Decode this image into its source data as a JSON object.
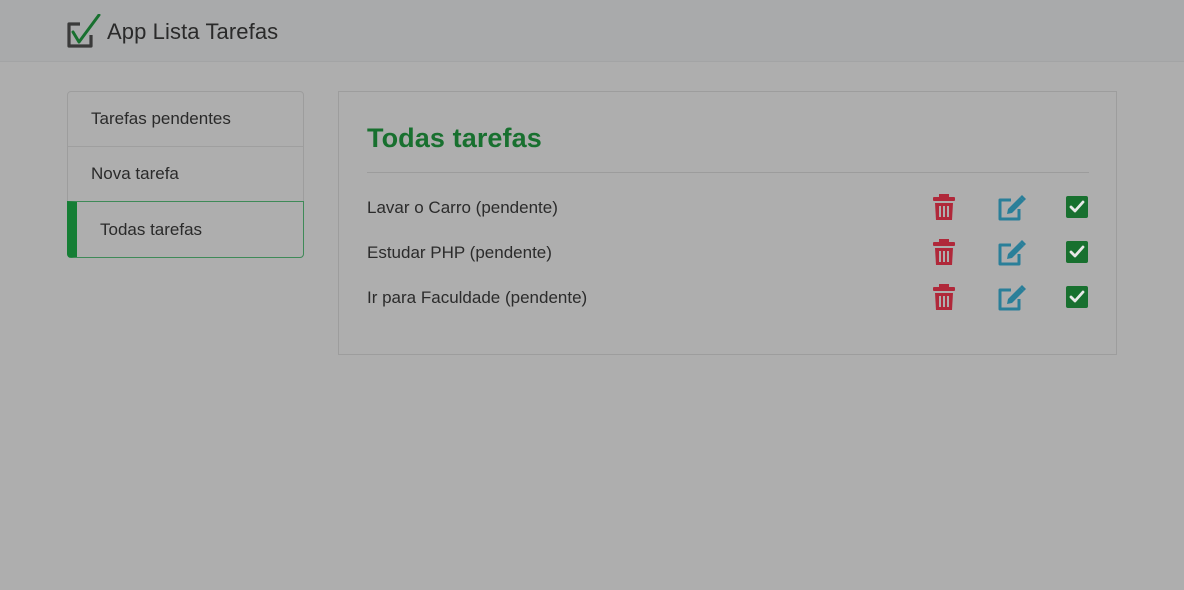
{
  "app": {
    "title": "App Lista Tarefas",
    "logo_icon": "checkbox-check-icon"
  },
  "menu": {
    "items": [
      {
        "label": "Tarefas pendentes",
        "active": false
      },
      {
        "label": "Nova tarefa",
        "active": false
      },
      {
        "label": "Todas tarefas",
        "active": true
      }
    ]
  },
  "main": {
    "title": "Todas tarefas",
    "tasks": [
      {
        "label": "Lavar o Carro (pendente)",
        "actions": [
          "trash-icon",
          "edit-icon",
          "check-square-icon"
        ]
      },
      {
        "label": "Estudar PHP (pendente)",
        "actions": [
          "trash-icon",
          "edit-icon",
          "check-square-icon"
        ]
      },
      {
        "label": "Ir para Faculdade (pendente)",
        "actions": [
          "trash-icon",
          "edit-icon",
          "check-square-icon"
        ]
      }
    ]
  },
  "colors": {
    "brand_green": "#18702f",
    "active_border": "#157e35",
    "delete_red": "#b0283a",
    "edit_teal": "#2a7f99",
    "done_green": "#18702f"
  }
}
